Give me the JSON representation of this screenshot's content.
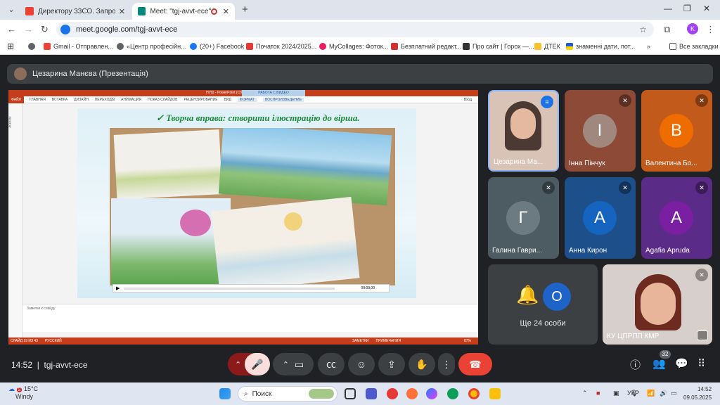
{
  "browser": {
    "tabs": [
      {
        "label": "Директору 33СО. Запрошення",
        "active": false
      },
      {
        "label": "Meet: \"tgj-avvt-ece\"",
        "active": true
      }
    ],
    "url": "meet.google.com/tgj-avvt-ece",
    "profile_initial": "K",
    "bookmarks": [
      "Gmail - Отправлен...",
      "«Центр професійн...",
      "(20+) Facebook",
      "Початок 2024/2025...",
      "MyCollages: Фоток...",
      "Безплатний редакт...",
      "Про сайт | Горох —...",
      "ДТЕК",
      "знаменні дати, пот..."
    ],
    "all_bookmarks": "Все закладки"
  },
  "meet": {
    "presenter": "Цезарина Манєва (Презентація)",
    "powerpoint": {
      "title": "НУШ - PowerPoint (Сбой активации продукта)",
      "context_tab": "РАБОТА С ВИДЕО",
      "ribbon": [
        "ФАЙЛ",
        "ГЛАВНАЯ",
        "ВСТАВКА",
        "ДИЗАЙН",
        "ПЕРЕХОДЫ",
        "АНИМАЦИЯ",
        "ПОКАЗ СЛАЙДОВ",
        "РЕЦЕНЗИРОВАНИЕ",
        "ВИД",
        "ФОРМАТ",
        "ВОСПРОИЗВЕДЕНИЕ"
      ],
      "login": "Вход",
      "thumbs_label": "Эскизы",
      "slide_heading": "✓ Творча вправа: створити ілюстрацію до вірша.",
      "video_time": "00:00,00",
      "notes": "Заметки к слайду",
      "status": [
        "СЛАЙД 19 ИЗ 43",
        "РУССКИЙ",
        "ЗАМЕТКИ",
        "ПРИМЕЧАНИЯ",
        "87%"
      ]
    },
    "tiles": [
      {
        "name": "Цезарина Ма...",
        "initial": "",
        "color": "#c8a896",
        "speaking": true
      },
      {
        "name": "Інна Пінчук",
        "initial": "І",
        "color": "#6d4c41",
        "muted": true
      },
      {
        "name": "Валентина Бо...",
        "initial": "В",
        "color": "#e65100",
        "muted": true
      },
      {
        "name": "Галина Гаври...",
        "initial": "Г",
        "color": "#455a64",
        "muted": true
      },
      {
        "name": "Анна Кирон",
        "initial": "А",
        "color": "#0d47a1",
        "muted": true
      },
      {
        "name": "Agafia Apruda",
        "initial": "A",
        "color": "#6a1b9a",
        "muted": true
      }
    ],
    "others": {
      "label": "Ще 24 особи",
      "initial": "О"
    },
    "self_tile": {
      "name": "КУ ЦПРПП КМР"
    },
    "time": "14:52",
    "meeting_code": "tgj-avvt-ece",
    "participants_count": "32"
  },
  "taskbar": {
    "weather_temp": "15°C",
    "weather_desc": "Windy",
    "weather_badge": "2",
    "search_label": "Поиск",
    "lang": "УКР",
    "time": "14:52",
    "date": "09.05.2025"
  }
}
